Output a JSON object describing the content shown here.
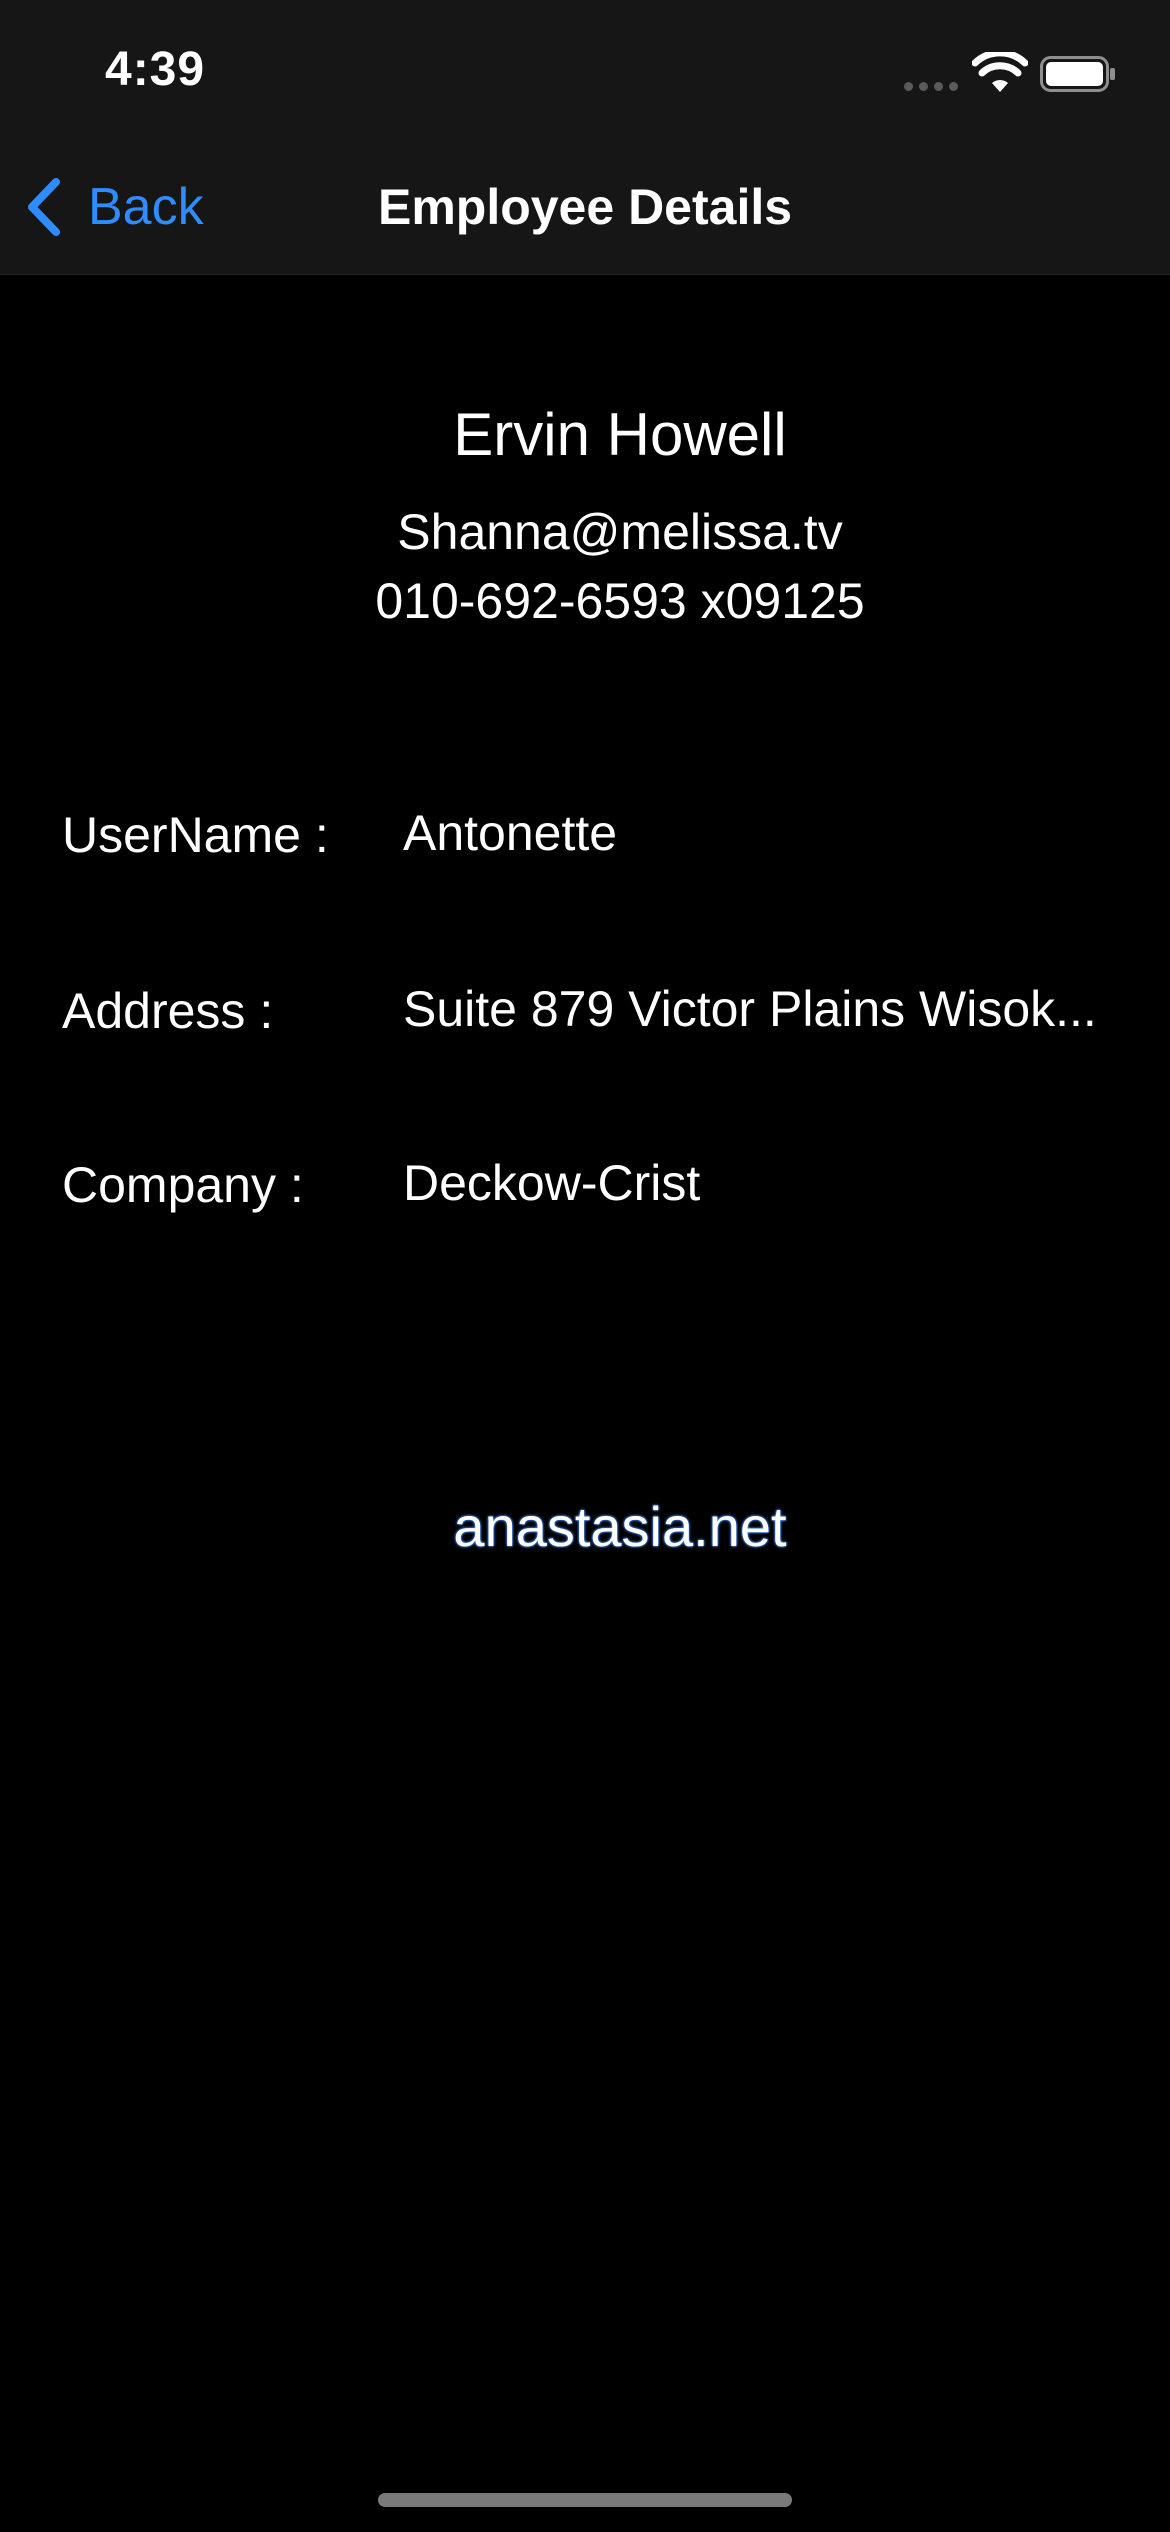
{
  "status_bar": {
    "time": "4:39"
  },
  "nav": {
    "back_label": "Back",
    "title": "Employee Details",
    "accent_color": "#2f8cff"
  },
  "employee": {
    "name": "Ervin Howell",
    "email": "Shanna@melissa.tv",
    "phone": "010-692-6593 x09125",
    "website": "anastasia.net"
  },
  "details": [
    {
      "label": "UserName :",
      "value": "Antonette"
    },
    {
      "label": "Address :",
      "value": "Suite 879 Victor Plains Wisok..."
    },
    {
      "label": "Company :",
      "value": "Deckow-Crist"
    }
  ],
  "icons": {
    "back": "chevron-left-icon",
    "signal": "cellular-signal-icon",
    "wifi": "wifi-icon",
    "battery": "battery-icon"
  }
}
